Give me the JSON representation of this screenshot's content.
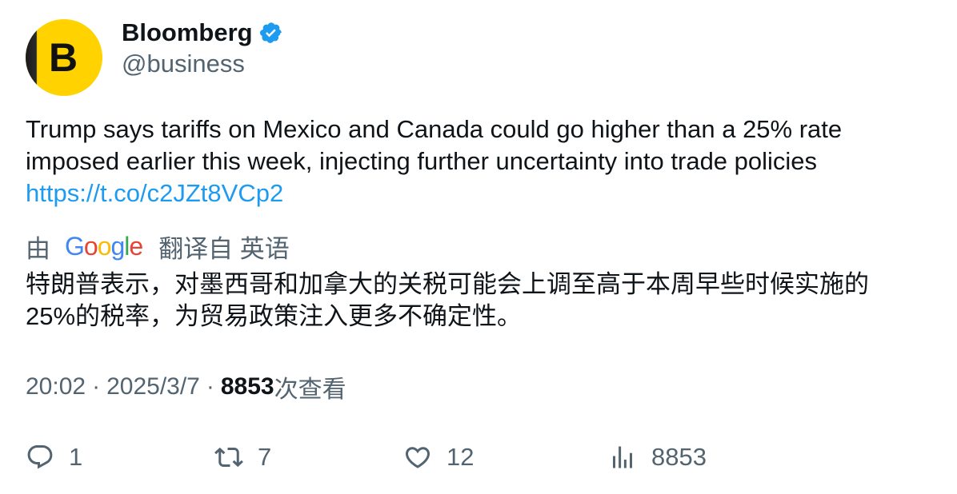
{
  "author": {
    "avatar_letter": "B",
    "display_name": "Bloomberg",
    "handle": "@business",
    "verified": true,
    "brand_color": "#ffd200"
  },
  "tweet": {
    "text_line_1": "Trump says tariffs on Mexico and Canada could go higher than a 25% rate",
    "text_line_2": "imposed earlier this week, injecting further uncertainty into trade policies",
    "link": "https://t.co/c2JZt8VCp2"
  },
  "translation": {
    "prefix": "由",
    "provider": "Google",
    "suffix": "翻译自 英语",
    "line_1": "特朗普表示，对墨西哥和加拿大的关税可能会上调至高于本周早些时候实施的",
    "line_2": "25%的税率，为贸易政策注入更多不确定性。"
  },
  "meta": {
    "time": "20:02",
    "separator": "·",
    "date": "2025/3/7",
    "views_count": "8853",
    "views_label": "次查看"
  },
  "actions": {
    "replies": "1",
    "retweets": "7",
    "likes": "12",
    "views": "8853"
  },
  "colors": {
    "text": "#0f1419",
    "secondary": "#536471",
    "link": "#1d9bf0",
    "verified": "#1d9bf0"
  },
  "icons": [
    "verified-badge-icon",
    "reply-icon",
    "retweet-icon",
    "like-icon",
    "views-icon"
  ]
}
